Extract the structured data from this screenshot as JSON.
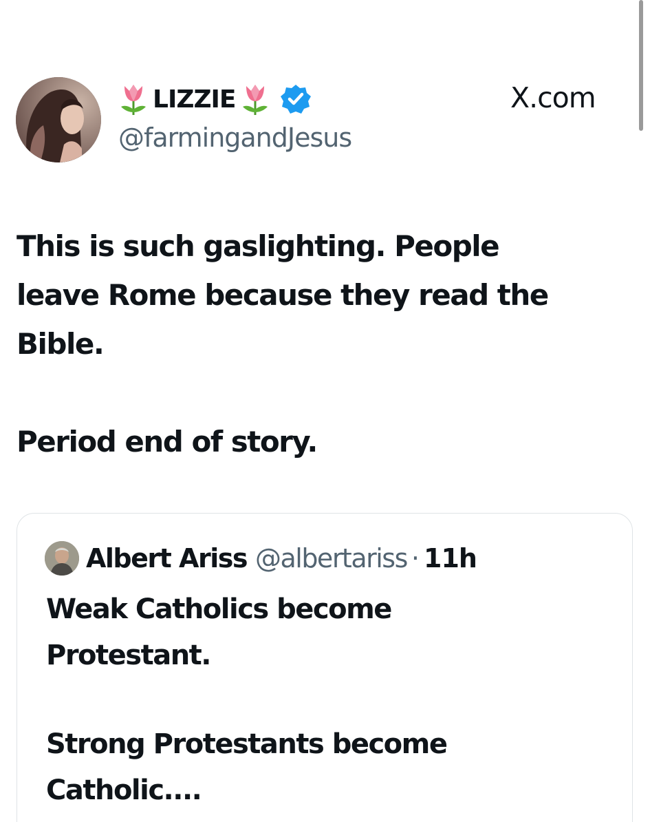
{
  "site": "X.com",
  "tweet": {
    "display_name": "LIZZIE",
    "name_emoji": "tulip-icon",
    "verified": true,
    "handle": "@farmingandJesus",
    "lines": [
      "This is such gaslighting. People",
      "leave Rome because they read the",
      "Bible.",
      "Period end of story."
    ]
  },
  "quoted": {
    "name": "Albert Ariss",
    "handle": "@albertariss",
    "separator": "·",
    "time": "11h",
    "lines": [
      "Weak Catholics become",
      "Protestant.",
      "Strong Protestants become",
      "Catholic...."
    ]
  },
  "colors": {
    "text": "#0f1419",
    "secondary": "#536471",
    "verified_blue": "#1d9bf0",
    "border": "#dfe3e6"
  }
}
